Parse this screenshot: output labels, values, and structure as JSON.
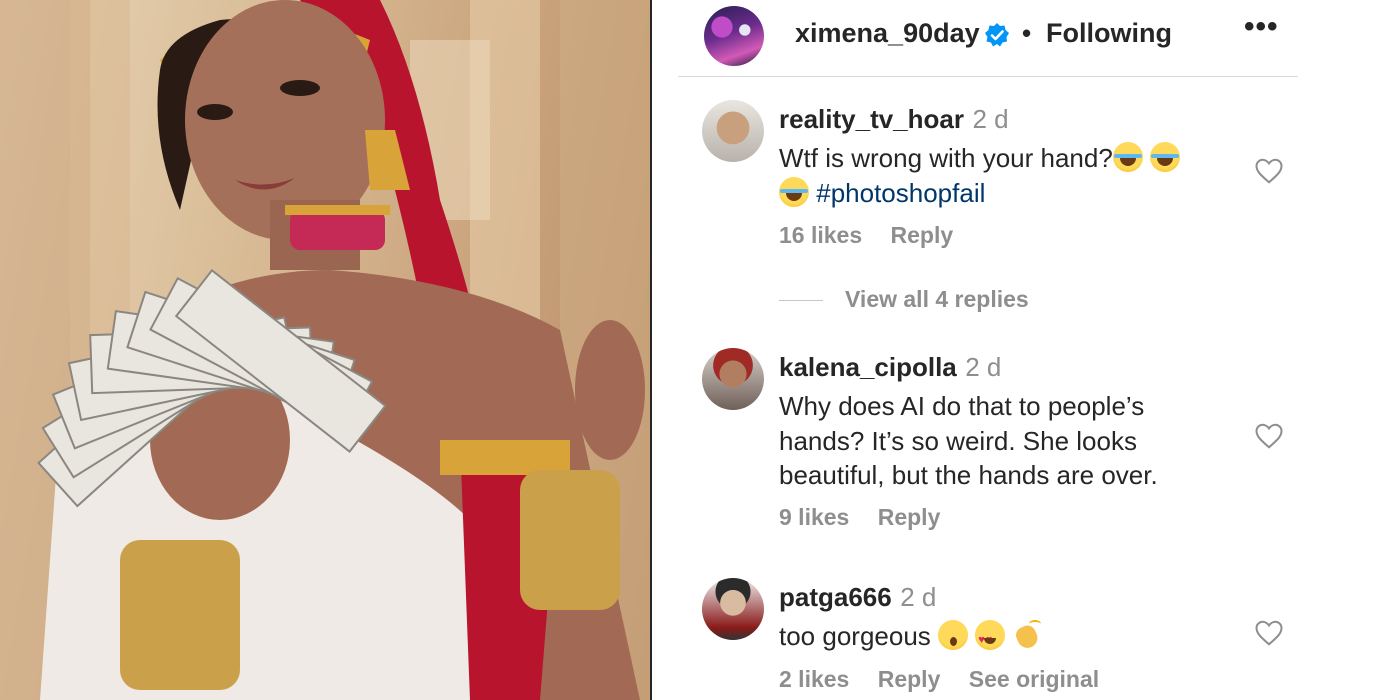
{
  "post": {
    "author": "ximena_90day",
    "verified": true,
    "separator": "•",
    "follow_status": "Following",
    "more_icon": "more-options-icon",
    "more_label": "•••"
  },
  "comments": [
    {
      "username": "reality_tv_hoar",
      "time": "2 d",
      "text": "Wtf is wrong with your hand?",
      "emojis": [
        "face-with-tears-of-joy",
        "face-with-tears-of-joy",
        "face-with-tears-of-joy"
      ],
      "hashtag": "#photoshopfail",
      "likes": "16 likes",
      "reply_label": "Reply",
      "view_replies": "View all 4 replies"
    },
    {
      "username": "kalena_cipolla",
      "time": "2 d",
      "text_lines": [
        "Why does AI do that to people’s",
        "hands? It’s so weird. She looks",
        "beautiful, but the hands are over."
      ],
      "likes": "9 likes",
      "reply_label": "Reply"
    },
    {
      "username": "patga666",
      "time": "2 d",
      "text": "too gorgeous",
      "emojis": [
        "face-with-open-mouth",
        "smiling-face-with-heart-eyes",
        "clapping-hands"
      ],
      "likes": "2 likes",
      "reply_label": "Reply",
      "see_original": "See original"
    }
  ],
  "colors": {
    "text": "#262626",
    "muted": "#8e8e8e",
    "hashtag": "#00376b",
    "verified": "#0095f6",
    "divider": "#dbdbdb"
  }
}
